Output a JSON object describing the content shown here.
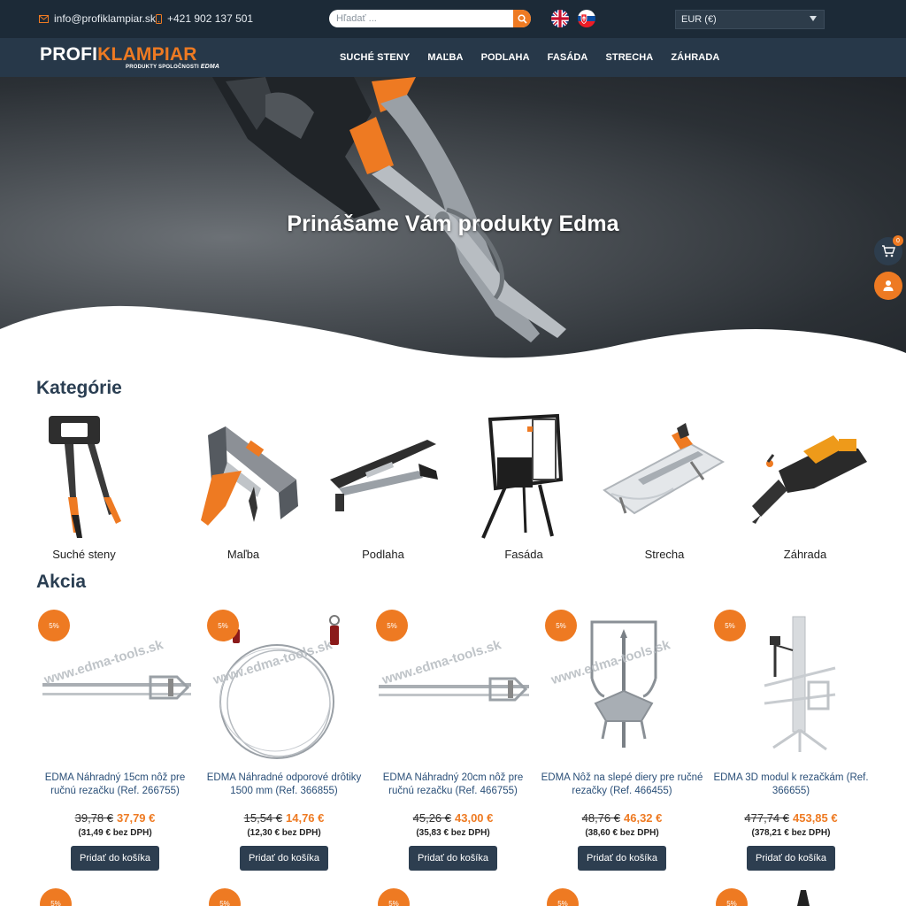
{
  "topbar": {
    "email": "info@profiklampiar.sk",
    "phone": "+421 902 137 501",
    "search_placeholder": "Hľadať ...",
    "currency": "EUR (€)",
    "languages": [
      "en",
      "sk"
    ]
  },
  "logo": {
    "part1": "PROFI",
    "part2": "KLAMPIAR",
    "tagline": "PRODUKTY SPOLOČNOSTI",
    "brand": "EDMA"
  },
  "nav": {
    "items": [
      "SUCHÉ STENY",
      "MAĽBA",
      "PODLAHA",
      "FASÁDA",
      "STRECHA",
      "ZÁHRADA"
    ]
  },
  "hero": {
    "title": "Prinášame Vám produkty Edma"
  },
  "side": {
    "cart_count": "0"
  },
  "categories": {
    "title": "Kategórie",
    "items": [
      "Suché steny",
      "Maľba",
      "Podlaha",
      "Fasáda",
      "Strecha",
      "Záhrada"
    ]
  },
  "sale": {
    "title": "Akcia",
    "watermark": "www.edma-tools.sk",
    "button_label": "Pridať do košíka",
    "products": [
      {
        "badge": "5%",
        "name": "EDMA Náhradný 15cm nôž pre ručnú rezačku (Ref. 266755)",
        "old_price": "39,78 €",
        "new_price": "37,79 €",
        "net_price": "(31,49 € bez DPH)"
      },
      {
        "badge": "5%",
        "name": "EDMA Náhradné odporové drôtiky 1500 mm (Ref. 366855)",
        "old_price": "15,54 €",
        "new_price": "14,76 €",
        "net_price": "(12,30 € bez DPH)"
      },
      {
        "badge": "5%",
        "name": "EDMA Náhradný 20cm nôž pre ručnú rezačku (Ref. 466755)",
        "old_price": "45,26 €",
        "new_price": "43,00 €",
        "net_price": "(35,83 € bez DPH)"
      },
      {
        "badge": "5%",
        "name": "EDMA Nôž na slepé diery pre ručné rezačky (Ref. 466455)",
        "old_price": "48,76 €",
        "new_price": "46,32 €",
        "net_price": "(38,60 € bez DPH)"
      },
      {
        "badge": "5%",
        "name": "EDMA 3D modul k rezačkám (Ref. 366655)",
        "old_price": "477,74 €",
        "new_price": "453,85 €",
        "net_price": "(378,21 € bez DPH)"
      }
    ],
    "next_row_badges": [
      "5%",
      "5%",
      "5%",
      "5%",
      "5%"
    ]
  },
  "colors": {
    "accent": "#ee7a22",
    "topbar": "#1c2a37",
    "navbar": "#273849",
    "button": "#2d3e50",
    "title": "#2a3e52",
    "link": "#2a4f78"
  }
}
